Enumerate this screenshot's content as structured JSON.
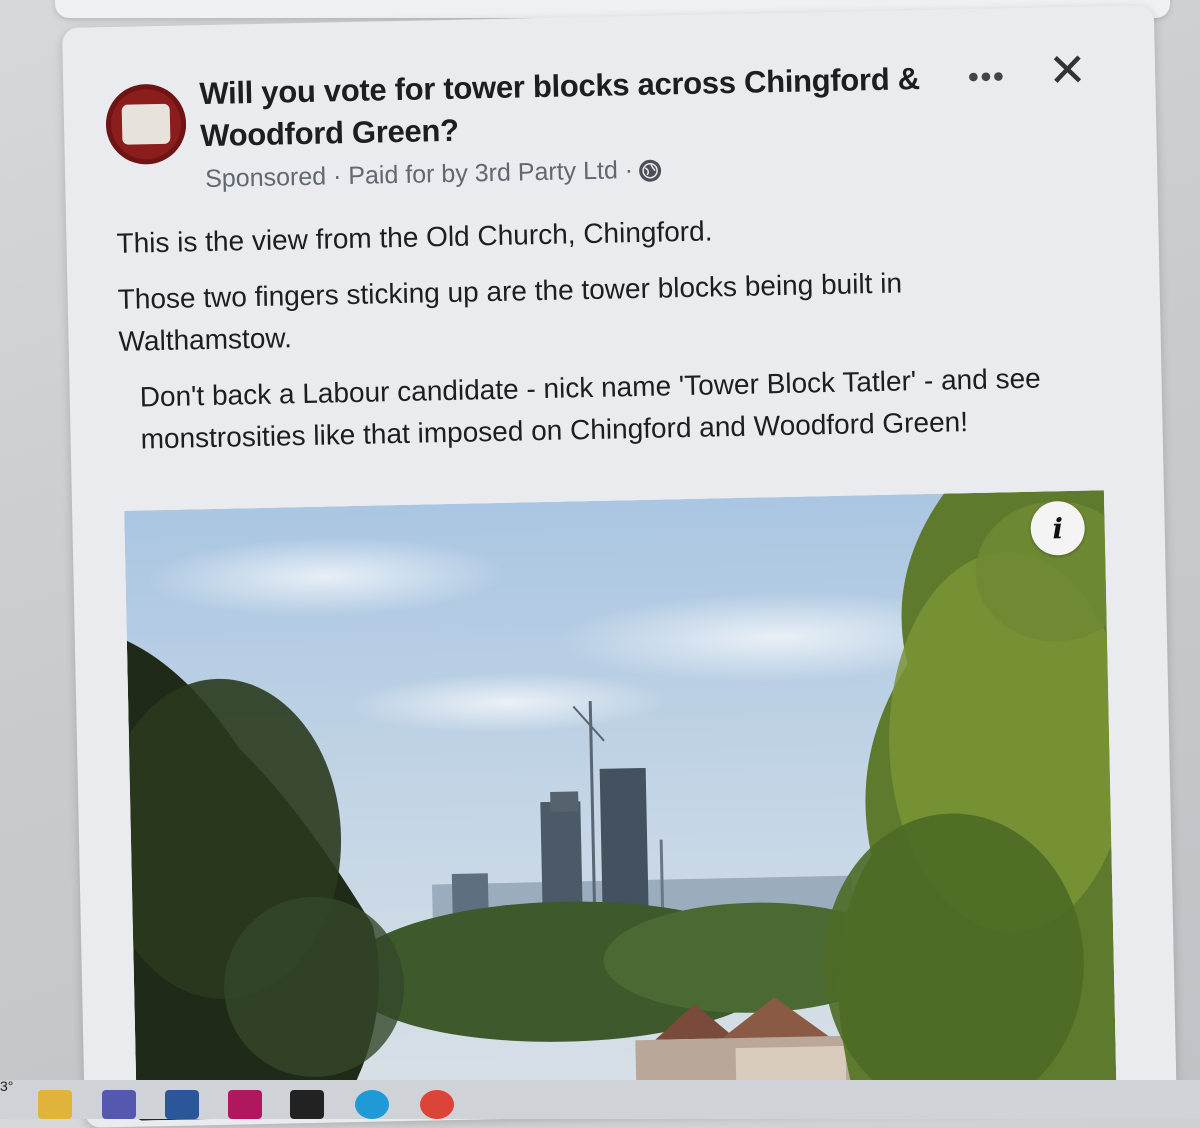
{
  "post": {
    "title": "Will you vote for tower blocks across Chingford & Woodford Green?",
    "meta_sponsored": "Sponsored · Paid for by 3rd Party Ltd ·",
    "paragraphs": [
      "This is the view from the Old Church, Chingford.",
      "Those two fingers sticking up are the tower blocks being built in Walthamstow.",
      "Don't back a Labour candidate - nick name 'Tower Block Tatler' - and see monstrosities like that imposed on Chingford and Woodford Green!"
    ],
    "more_icon": "more-horizontal-icon",
    "close_icon": "close-icon",
    "info_label": "i"
  },
  "taskbar": {
    "temperature": "3°",
    "icons": [
      "file-explorer-icon",
      "teams-icon",
      "store-icon",
      "app-icon",
      "xbox-icon",
      "edge-icon",
      "chrome-icon"
    ]
  },
  "colors": {
    "avatar": "#8c1d1d",
    "card": "#e9ebee",
    "text": "#1c1e21",
    "meta": "#606770"
  }
}
